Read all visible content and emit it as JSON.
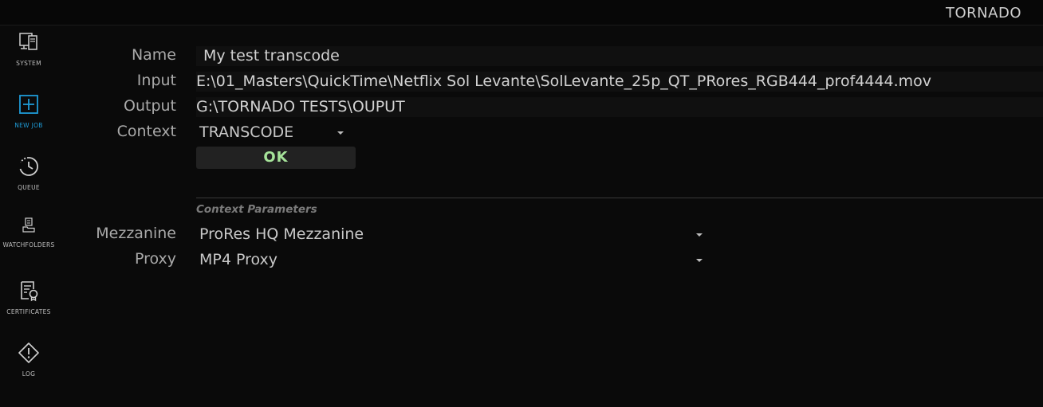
{
  "app": {
    "brand": "TORNADO"
  },
  "sidebar": {
    "items": [
      {
        "label": "SYSTEM",
        "icon": "system-icon"
      },
      {
        "label": "NEW JOB",
        "icon": "new-job-icon",
        "active": true
      },
      {
        "label": "QUEUE",
        "icon": "queue-icon"
      },
      {
        "label": "WATCHFOLDERS",
        "icon": "watchfolders-icon"
      },
      {
        "label": "CERTIFICATES",
        "icon": "certificates-icon"
      },
      {
        "label": "LOG",
        "icon": "log-icon"
      }
    ]
  },
  "form": {
    "name_label": "Name",
    "name_value": "My test transcode",
    "input_label": "Input",
    "input_value": "E:\\01_Masters\\QuickTime\\Netflix Sol Levante\\SolLevante_25p_QT_PRores_RGB444_prof4444.mov",
    "output_label": "Output",
    "output_value": "G:\\TORNADO TESTS\\OUPUT",
    "context_label": "Context",
    "context_value": "TRANSCODE",
    "ok_label": "OK"
  },
  "context_parameters": {
    "title": "Context Parameters",
    "mezzanine_label": "Mezzanine",
    "mezzanine_value": "ProRes HQ Mezzanine",
    "proxy_label": "Proxy",
    "proxy_value": "MP4 Proxy"
  },
  "colors": {
    "accent": "#1e9bd6",
    "ok_text": "#a6e39a",
    "background": "#0a0a0a"
  }
}
